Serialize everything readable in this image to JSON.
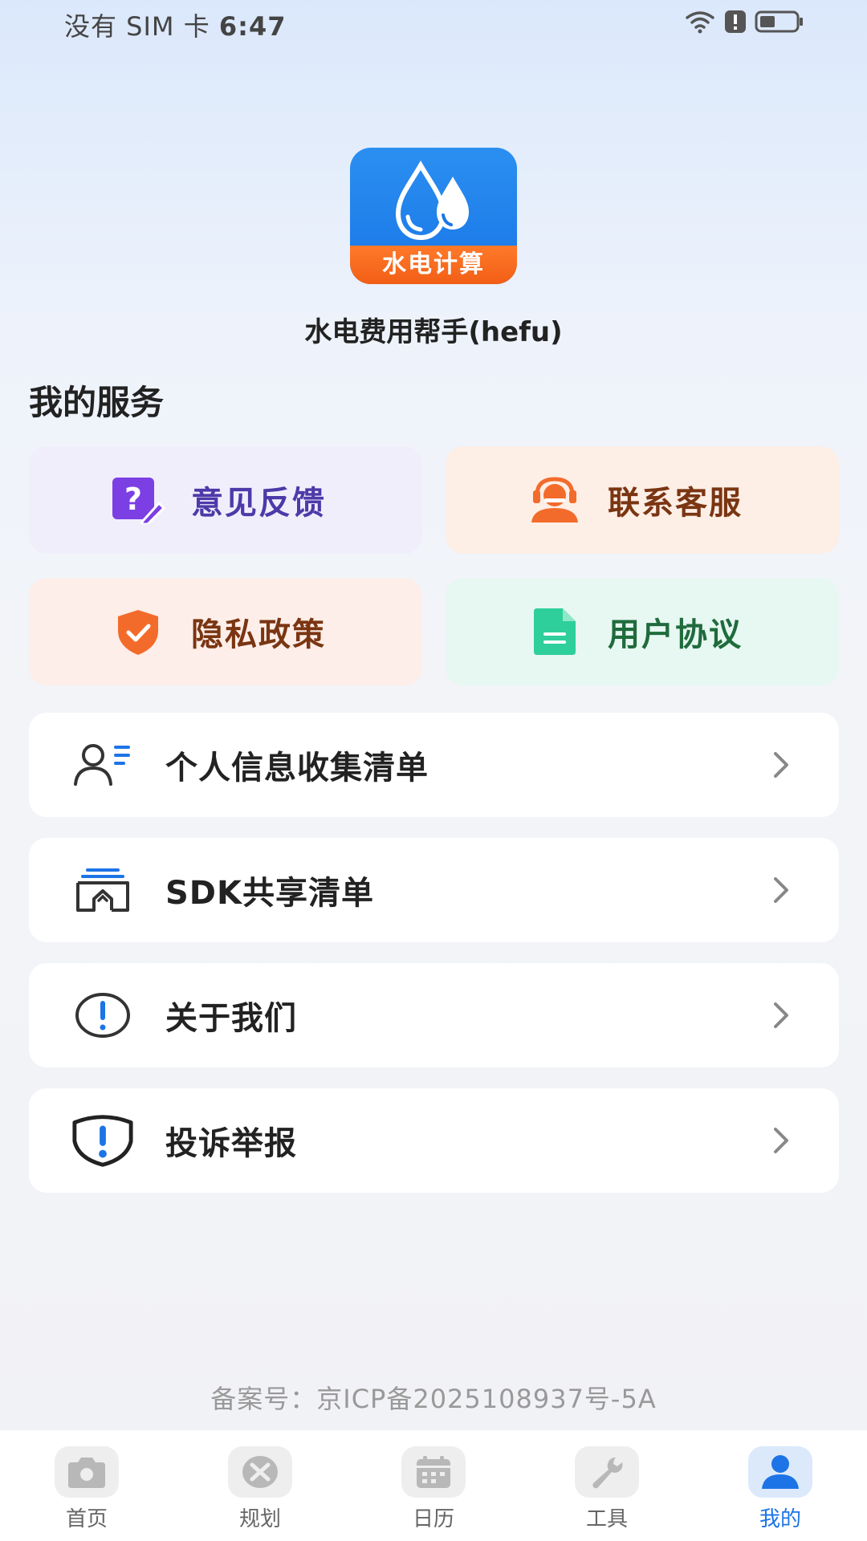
{
  "status_bar": {
    "carrier": "没有 SIM 卡",
    "time": "6:47",
    "icons": [
      "wifi-icon",
      "alert-icon",
      "battery-icon"
    ]
  },
  "app": {
    "logo_text": "水电计算",
    "name": "水电费用帮手(hefu)"
  },
  "services": {
    "title": "我的服务",
    "cards": [
      {
        "label": "意见反馈",
        "icon": "feedback-icon",
        "color": "#7b3fe4"
      },
      {
        "label": "联系客服",
        "icon": "customer-service-icon",
        "color": "#f36b2b"
      },
      {
        "label": "隐私政策",
        "icon": "privacy-shield-icon",
        "color": "#f36b2b"
      },
      {
        "label": "用户协议",
        "icon": "document-icon",
        "color": "#2ecf9a"
      }
    ]
  },
  "menu": {
    "items": [
      {
        "label": "个人信息收集清单",
        "icon": "user-list-icon"
      },
      {
        "label": "SDK共享清单",
        "icon": "sdk-share-icon"
      },
      {
        "label": "关于我们",
        "icon": "info-icon"
      },
      {
        "label": "投诉举报",
        "icon": "report-shield-icon"
      }
    ]
  },
  "footer": {
    "icp": "备案号：京ICP备2025108937号-5A"
  },
  "tab_bar": {
    "tabs": [
      {
        "label": "首页",
        "icon": "home-camera-icon",
        "active": false
      },
      {
        "label": "规划",
        "icon": "plan-icon",
        "active": false
      },
      {
        "label": "日历",
        "icon": "calendar-icon",
        "active": false
      },
      {
        "label": "工具",
        "icon": "wrench-icon",
        "active": false
      },
      {
        "label": "我的",
        "icon": "profile-icon",
        "active": true
      }
    ]
  },
  "colors": {
    "accent": "#1d74e6",
    "logo_blue": "#1976e8",
    "logo_orange": "#f25e16"
  }
}
